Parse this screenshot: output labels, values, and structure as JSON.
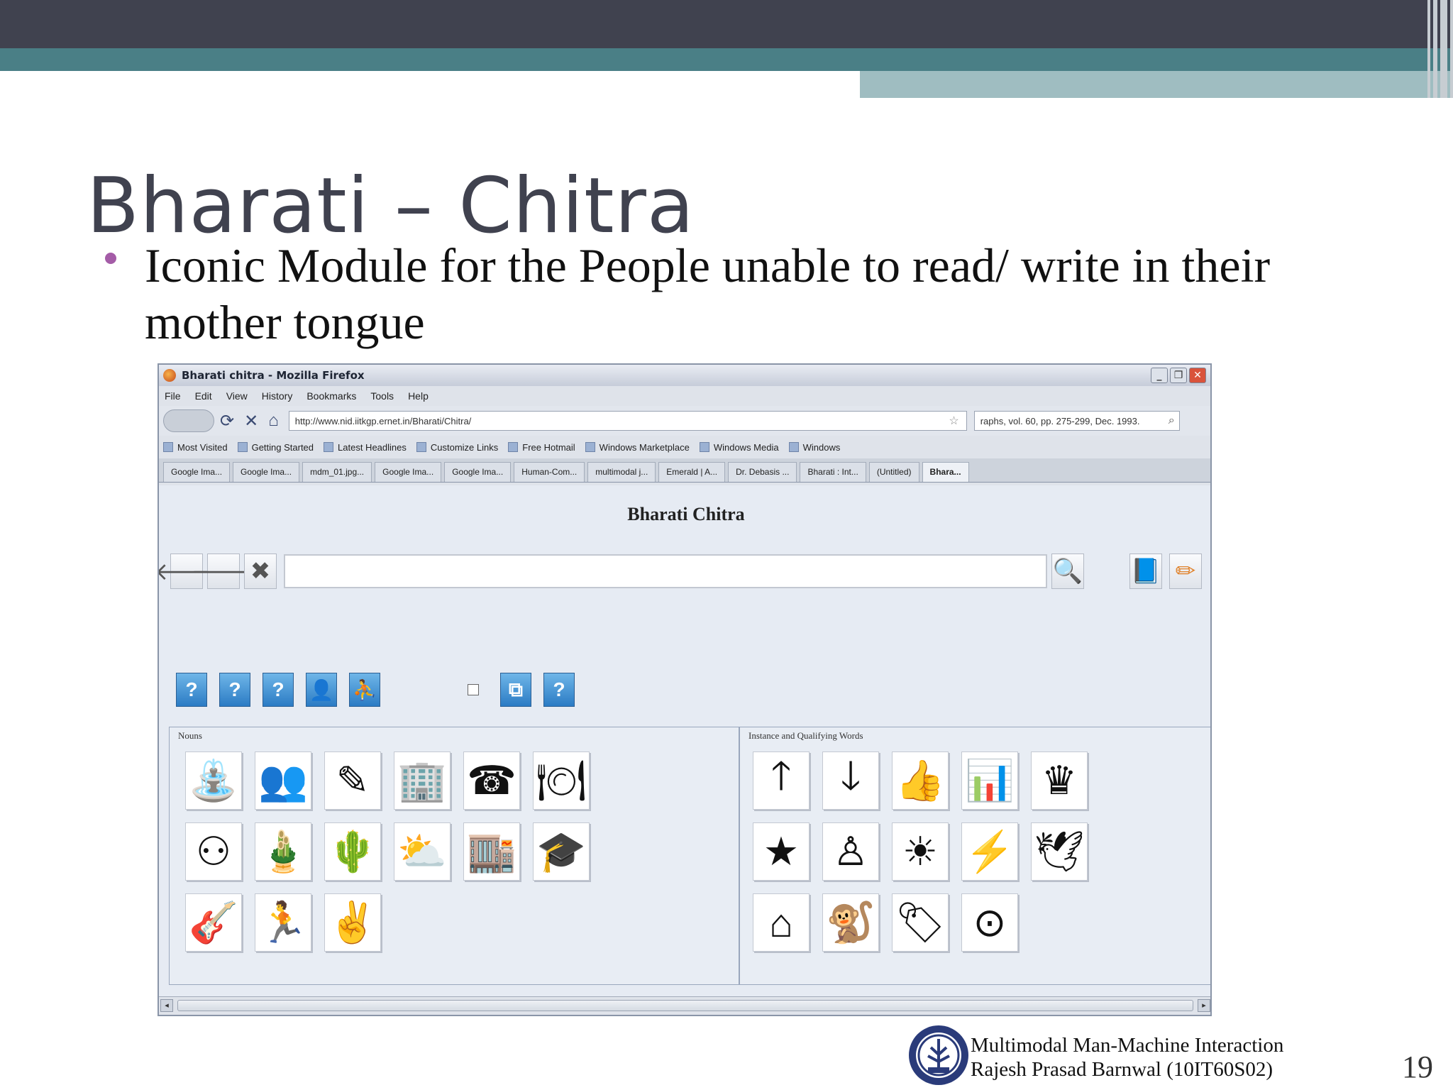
{
  "slide": {
    "title": "Bharati – Chitra",
    "bullet": "Iconic Module for the People unable to read/ write in their mother tongue",
    "footer_line1": "Multimodal Man-Machine Interaction",
    "footer_line2": "Rajesh Prasad Barnwal (10IT60S02)",
    "page_number": "19"
  },
  "browser": {
    "window_title": "Bharati chitra - Mozilla Firefox",
    "menu": [
      "File",
      "Edit",
      "View",
      "History",
      "Bookmarks",
      "Tools",
      "Help"
    ],
    "url": "http://www.nid.iitkgp.ernet.in/Bharati/Chitra/",
    "search_value": "raphs, vol. 60, pp. 275-299, Dec. 1993.",
    "bookmarks": [
      "Most Visited",
      "Getting Started",
      "Latest Headlines",
      "Customize Links",
      "Free Hotmail",
      "Windows Marketplace",
      "Windows Media",
      "Windows"
    ],
    "tabs": [
      "Google Ima...",
      "Google Ima...",
      "mdm_01.jpg...",
      "Google Ima...",
      "Google Ima...",
      "Human-Com...",
      "multimodal j...",
      "Emerald | A...",
      "Dr. Debasis ...",
      "Bharati : Int...",
      "(Untitled)",
      "Bhara..."
    ],
    "active_tab": "Bhara..."
  },
  "page": {
    "heading": "Bharati Chitra",
    "nouns_label": "Nouns",
    "qualifiers_label": "Instance and Qualifying Words",
    "top_buttons": {
      "back": "🡐",
      "forward": "🡒",
      "clear": "✖",
      "search": "🔍",
      "book": "📘",
      "pencil": "✏"
    },
    "category_icons": [
      "?",
      "?",
      "?",
      "👤",
      "⛹",
      "⧉",
      "?"
    ],
    "noun_icons": [
      "⛲",
      "👥",
      "✎",
      "🏢",
      "☎",
      "🍽",
      "⚇",
      "🎍",
      "🌵",
      "⛅",
      "🏬",
      "🎓",
      "🎸",
      "🏃",
      "✌"
    ],
    "qualifier_icons": [
      "🡑",
      "🡓",
      "👍",
      "📊",
      "♛",
      "★",
      "♙",
      "☀",
      "⚡",
      "🕊",
      "⌂",
      "🐒",
      "🏷",
      "⊙"
    ]
  },
  "colors": {
    "header_dark": "#40424f",
    "header_teal": "#4a7f86",
    "bullet": "#a45ca7"
  }
}
